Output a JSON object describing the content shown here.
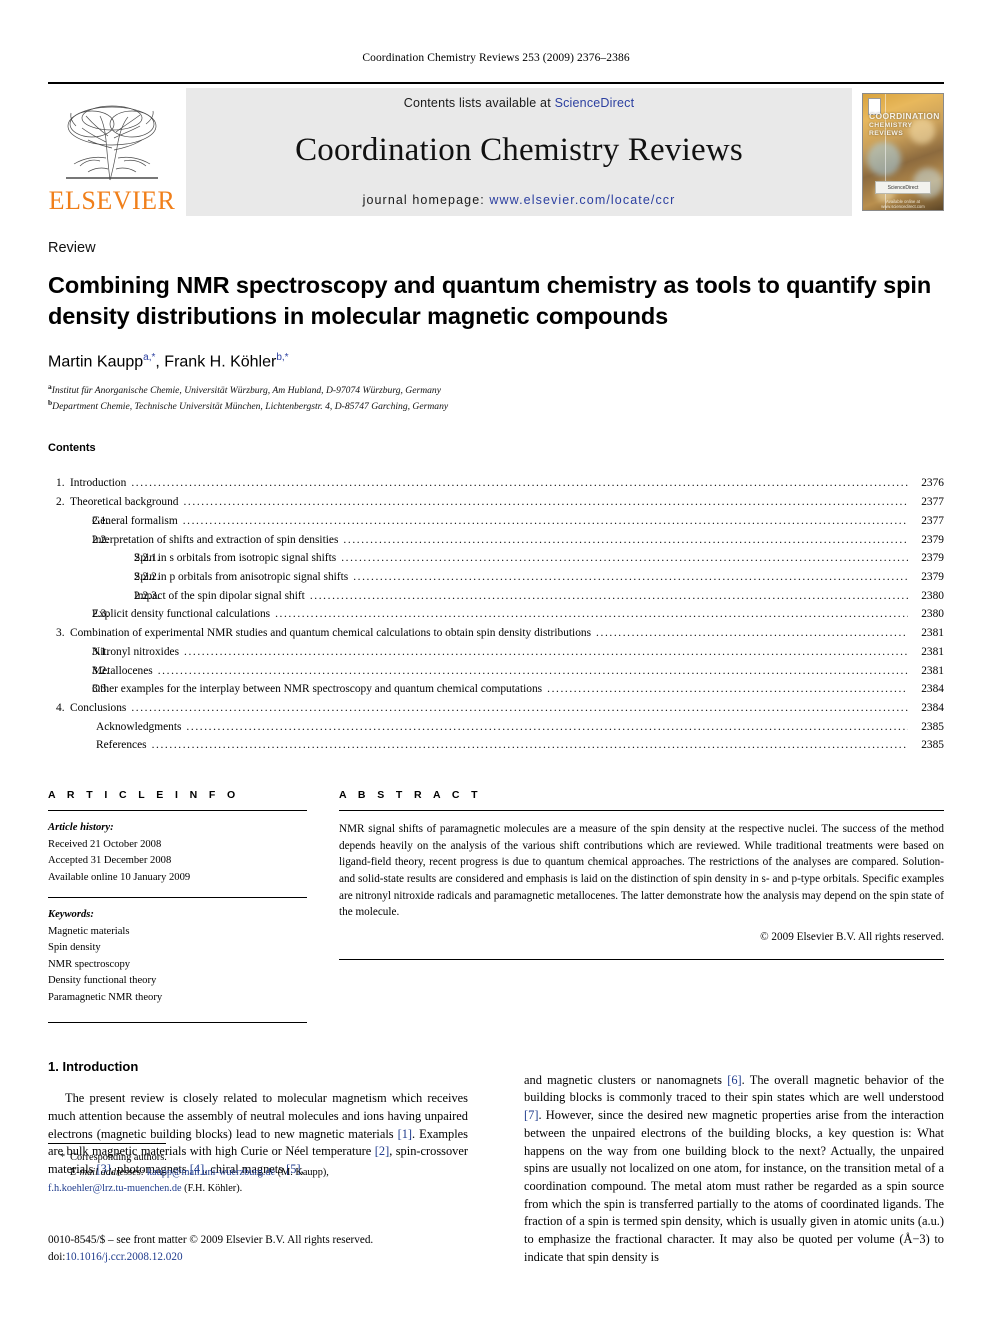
{
  "running_head": "Coordination Chemistry Reviews 253 (2009) 2376–2386",
  "masthead": {
    "contents_lists_label": "Contents lists available at",
    "sciencedirect": "ScienceDirect",
    "journal_title": "Coordination Chemistry Reviews",
    "homepage_label": "journal homepage:",
    "homepage_url": "www.elsevier.com/locate/ccr",
    "publisher": "ELSEVIER",
    "cover": {
      "line1": "COORDINATION",
      "line2": "CHEMISTRY REVIEWS",
      "badge": "ScienceDirect",
      "footline": "Available online at www.sciencedirect.com"
    },
    "accent_orange": "#F07F1A",
    "link_blue": "#2b3fa0",
    "band_gray": "#e9e9e9"
  },
  "article": {
    "doctype": "Review",
    "title": "Combining NMR spectroscopy and quantum chemistry as tools to quantify spin density distributions in molecular magnetic compounds",
    "authors": [
      {
        "name": "Martin Kaupp",
        "sup": "a,*"
      },
      {
        "name": "Frank H. Köhler",
        "sup": "b,*"
      }
    ],
    "author_line_separator": ", ",
    "affiliations": [
      {
        "marker": "a",
        "text": "Institut für Anorganische Chemie, Universität Würzburg, Am Hubland, D-97074 Würzburg, Germany"
      },
      {
        "marker": "b",
        "text": "Department Chemie, Technische Universität München, Lichtenbergstr. 4, D-85747 Garching, Germany"
      }
    ]
  },
  "contents": {
    "heading": "Contents",
    "entries": [
      {
        "level": 1,
        "num": "1.",
        "label": "Introduction",
        "page": "2376"
      },
      {
        "level": 1,
        "num": "2.",
        "label": "Theoretical background",
        "page": "2377"
      },
      {
        "level": 2,
        "num": "2.1.",
        "label": "General formalism",
        "page": "2377"
      },
      {
        "level": 2,
        "num": "2.2.",
        "label": "Interpretation of shifts and extraction of spin densities",
        "page": "2379"
      },
      {
        "level": 3,
        "num": "2.2.1.",
        "label": "Spin in s orbitals from isotropic signal shifts",
        "page": "2379"
      },
      {
        "level": 3,
        "num": "2.2.2.",
        "label": "Spin in p orbitals from anisotropic signal shifts",
        "page": "2379"
      },
      {
        "level": 3,
        "num": "2.2.3.",
        "label": "Impact of the spin dipolar signal shift",
        "page": "2380"
      },
      {
        "level": 2,
        "num": "2.3.",
        "label": "Explicit density functional calculations",
        "page": "2380"
      },
      {
        "level": 1,
        "num": "3.",
        "label": "Combination of experimental NMR studies and quantum chemical calculations to obtain spin density distributions",
        "page": "2381"
      },
      {
        "level": 2,
        "num": "3.1.",
        "label": "Nitronyl nitroxides",
        "page": "2381"
      },
      {
        "level": 2,
        "num": "3.2.",
        "label": "Metallocenes",
        "page": "2381"
      },
      {
        "level": 2,
        "num": "3.3.",
        "label": "Other examples for the interplay between NMR spectroscopy and quantum chemical computations",
        "page": "2384"
      },
      {
        "level": 1,
        "num": "4.",
        "label": "Conclusions",
        "page": "2384"
      },
      {
        "level": 0,
        "num": "",
        "label": "Acknowledgments",
        "page": "2385"
      },
      {
        "level": 0,
        "num": "",
        "label": "References",
        "page": "2385"
      }
    ]
  },
  "article_info": {
    "section_label": "A R T I C L E    I N F O",
    "history_label": "Article history:",
    "history": [
      "Received 21 October 2008",
      "Accepted 31 December 2008",
      "Available online 10 January 2009"
    ],
    "keywords_label": "Keywords:",
    "keywords": [
      "Magnetic materials",
      "Spin density",
      "NMR spectroscopy",
      "Density functional theory",
      "Paramagnetic NMR theory"
    ]
  },
  "abstract": {
    "section_label": "A B S T R A C T",
    "text": "NMR signal shifts of paramagnetic molecules are a measure of the spin density at the respective nuclei. The success of the method depends heavily on the analysis of the various shift contributions which are reviewed. While traditional treatments were based on ligand-field theory, recent progress is due to quantum chemical approaches. The restrictions of the analyses are compared. Solution- and solid-state results are considered and emphasis is laid on the distinction of spin density in s- and p-type orbitals. Specific examples are nitronyl nitroxide radicals and paramagnetic metallocenes. The latter demonstrate how the analysis may depend on the spin state of the molecule.",
    "copyright": "© 2009 Elsevier B.V. All rights reserved."
  },
  "introduction": {
    "heading": "1.  Introduction",
    "left_paragraph_parts": [
      "The present review is closely related to molecular magnetism which receives much attention because the assembly of neutral molecules and ions having unpaired electrons (magnetic building blocks) lead to new magnetic materials ",
      "[1]",
      ". Examples are bulk magnetic materials with high Curie or Néel temperature ",
      "[2]",
      ", spin-crossover materials ",
      "[3]",
      ", photomagnets ",
      "[4]",
      ", chiral magnets ",
      "[5]",
      ","
    ],
    "right_paragraph_parts": [
      "and magnetic clusters or nanomagnets ",
      "[6]",
      ". The overall magnetic behavior of the building blocks is commonly traced to their spin states which are well understood ",
      "[7]",
      ". However, since the desired new magnetic properties arise from the interaction between the unpaired electrons of the building blocks, a key question is: What happens on the way from one building block to the next? Actually, the unpaired spins are usually not localized on one atom, for instance, on the transition metal of a coordination compound. The metal atom must rather be regarded as a spin source from which the spin is transferred partially to the atoms of coordinated ligands. The fraction of a spin is termed spin density, which is usually given in atomic units (a.u.) to emphasize the fractional character. It may also be quoted per volume (Å−3) to indicate that spin density is"
    ]
  },
  "footnotes": {
    "corresponding": "Corresponding authors.",
    "star": "*",
    "email_label": "E-mail addresses:",
    "email1": "kaupp@mail.uni-wuerzburg.de",
    "email1_owner": "(M. Kaupp),",
    "email2": "f.h.koehler@lrz.tu-muenchen.de",
    "email2_owner": "(F.H. Köhler)."
  },
  "imprint": {
    "issn_line": "0010-8545/$ – see front matter © 2009 Elsevier B.V. All rights reserved.",
    "doi_label": "doi:",
    "doi_value": "10.1016/j.ccr.2008.12.020"
  }
}
